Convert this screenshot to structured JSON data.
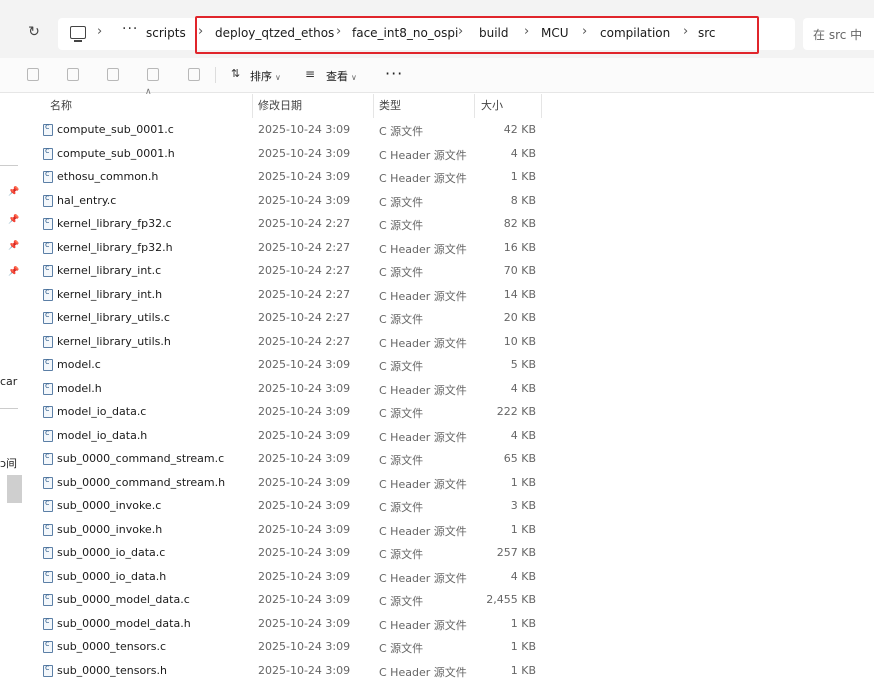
{
  "breadcrumb": [
    "scripts",
    "deploy_qtzed_ethos",
    "face_int8_no_ospi",
    "build",
    "MCU",
    "compilation",
    "src"
  ],
  "breadcrumb_overflow": "···",
  "search_placeholder": "在 src 中",
  "toolbar": {
    "sort_label": "排序",
    "view_label": "查看",
    "more_label": "···"
  },
  "columns": {
    "name": "名称",
    "date": "修改日期",
    "type": "类型",
    "size": "大小"
  },
  "sidebar": {
    "cut_label_1": "car",
    "cut_label_2": "ɔ间"
  },
  "files": [
    {
      "name": "compute_sub_0001.c",
      "date": "2025-10-24 3:09",
      "type": "C 源文件",
      "size": "42 KB"
    },
    {
      "name": "compute_sub_0001.h",
      "date": "2025-10-24 3:09",
      "type": "C Header 源文件",
      "size": "4 KB"
    },
    {
      "name": "ethosu_common.h",
      "date": "2025-10-24 3:09",
      "type": "C Header 源文件",
      "size": "1 KB"
    },
    {
      "name": "hal_entry.c",
      "date": "2025-10-24 3:09",
      "type": "C 源文件",
      "size": "8 KB"
    },
    {
      "name": "kernel_library_fp32.c",
      "date": "2025-10-24 2:27",
      "type": "C 源文件",
      "size": "82 KB"
    },
    {
      "name": "kernel_library_fp32.h",
      "date": "2025-10-24 2:27",
      "type": "C Header 源文件",
      "size": "16 KB"
    },
    {
      "name": "kernel_library_int.c",
      "date": "2025-10-24 2:27",
      "type": "C 源文件",
      "size": "70 KB"
    },
    {
      "name": "kernel_library_int.h",
      "date": "2025-10-24 2:27",
      "type": "C Header 源文件",
      "size": "14 KB"
    },
    {
      "name": "kernel_library_utils.c",
      "date": "2025-10-24 2:27",
      "type": "C 源文件",
      "size": "20 KB"
    },
    {
      "name": "kernel_library_utils.h",
      "date": "2025-10-24 2:27",
      "type": "C Header 源文件",
      "size": "10 KB"
    },
    {
      "name": "model.c",
      "date": "2025-10-24 3:09",
      "type": "C 源文件",
      "size": "5 KB"
    },
    {
      "name": "model.h",
      "date": "2025-10-24 3:09",
      "type": "C Header 源文件",
      "size": "4 KB"
    },
    {
      "name": "model_io_data.c",
      "date": "2025-10-24 3:09",
      "type": "C 源文件",
      "size": "222 KB"
    },
    {
      "name": "model_io_data.h",
      "date": "2025-10-24 3:09",
      "type": "C Header 源文件",
      "size": "4 KB"
    },
    {
      "name": "sub_0000_command_stream.c",
      "date": "2025-10-24 3:09",
      "type": "C 源文件",
      "size": "65 KB"
    },
    {
      "name": "sub_0000_command_stream.h",
      "date": "2025-10-24 3:09",
      "type": "C Header 源文件",
      "size": "1 KB"
    },
    {
      "name": "sub_0000_invoke.c",
      "date": "2025-10-24 3:09",
      "type": "C 源文件",
      "size": "3 KB"
    },
    {
      "name": "sub_0000_invoke.h",
      "date": "2025-10-24 3:09",
      "type": "C Header 源文件",
      "size": "1 KB"
    },
    {
      "name": "sub_0000_io_data.c",
      "date": "2025-10-24 3:09",
      "type": "C 源文件",
      "size": "257 KB"
    },
    {
      "name": "sub_0000_io_data.h",
      "date": "2025-10-24 3:09",
      "type": "C Header 源文件",
      "size": "4 KB"
    },
    {
      "name": "sub_0000_model_data.c",
      "date": "2025-10-24 3:09",
      "type": "C 源文件",
      "size": "2,455 KB"
    },
    {
      "name": "sub_0000_model_data.h",
      "date": "2025-10-24 3:09",
      "type": "C Header 源文件",
      "size": "1 KB"
    },
    {
      "name": "sub_0000_tensors.c",
      "date": "2025-10-24 3:09",
      "type": "C 源文件",
      "size": "1 KB"
    },
    {
      "name": "sub_0000_tensors.h",
      "date": "2025-10-24 3:09",
      "type": "C Header 源文件",
      "size": "1 KB"
    }
  ]
}
